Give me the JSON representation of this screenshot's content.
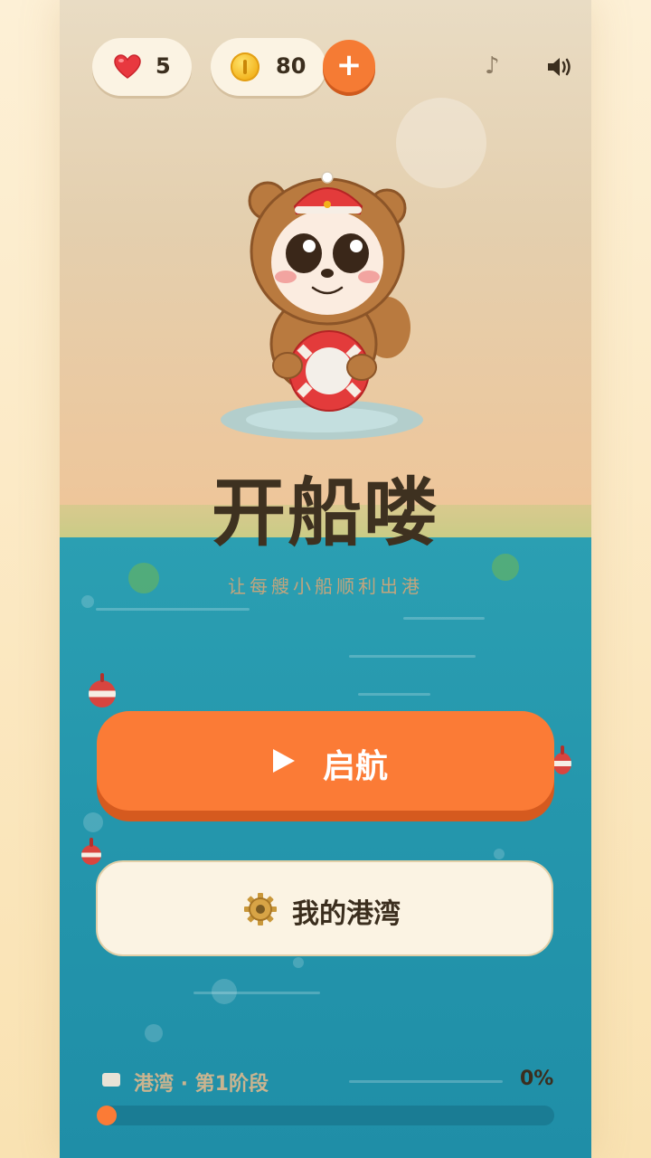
{
  "status_bar": {
    "lives": "5",
    "coins": "80",
    "plus_label": "+",
    "music_glyph": "♪"
  },
  "title": "开船喽",
  "subtitle": "让每艘小船顺利出港",
  "buttons": {
    "start_label": "启航",
    "harbor_label": "我的港湾"
  },
  "stage": {
    "label": "港湾 · 第1阶段",
    "percent_text": "0%",
    "progress": 0
  },
  "icons": {
    "heart": "heart-icon",
    "coin": "coin-icon",
    "music": "music-note-icon",
    "speaker": "speaker-icon",
    "play": "play-icon",
    "gear": "gear-icon",
    "stage": "folder-icon"
  },
  "colors": {
    "accent": "#fb7b36",
    "sea": "#2597ad",
    "text_dark": "#3b2e1e",
    "cream": "#fbf3e3"
  }
}
